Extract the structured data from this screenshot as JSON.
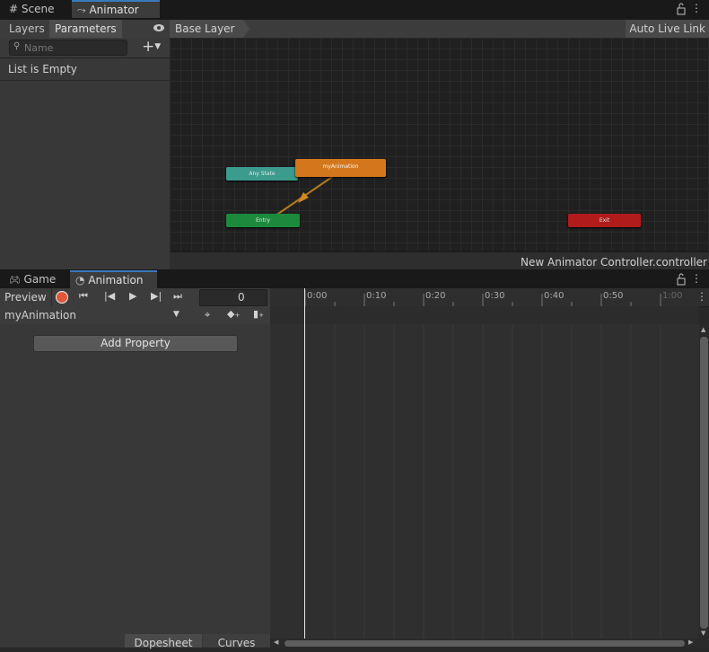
{
  "top_tabs": [
    {
      "label": "Scene",
      "icon": "grid-icon"
    },
    {
      "label": "Animator",
      "icon": "animator-icon"
    }
  ],
  "animator": {
    "left_tabs": {
      "layers": "Layers",
      "parameters": "Parameters"
    },
    "search_placeholder": "Name",
    "empty_text": "List is Empty",
    "breadcrumb": "Base Layer",
    "auto_live_link": "Auto Live Link",
    "states": {
      "any_state": "Any State",
      "my_animation": "myAnimation",
      "entry": "Entry",
      "exit": "Exit"
    },
    "status_path": "New Animator Controller.controller"
  },
  "bottom_tabs": [
    {
      "label": "Game",
      "icon": "gamepad-icon"
    },
    {
      "label": "Animation",
      "icon": "clock-icon"
    }
  ],
  "animation": {
    "preview": "Preview",
    "frame": "0",
    "clip": "myAnimation",
    "add_property": "Add Property",
    "dopesheet": "Dopesheet",
    "curves": "Curves",
    "timeline_labels": [
      "0:00",
      "0:10",
      "0:20",
      "0:30",
      "0:40",
      "0:50",
      "1:00"
    ]
  },
  "colors": {
    "any_state": "#3b9b8d",
    "default_state": "#d4771c",
    "entry": "#1c8a3c",
    "exit": "#b11b1b",
    "record": "#e2573a",
    "active_tab": "#3a79bb"
  }
}
